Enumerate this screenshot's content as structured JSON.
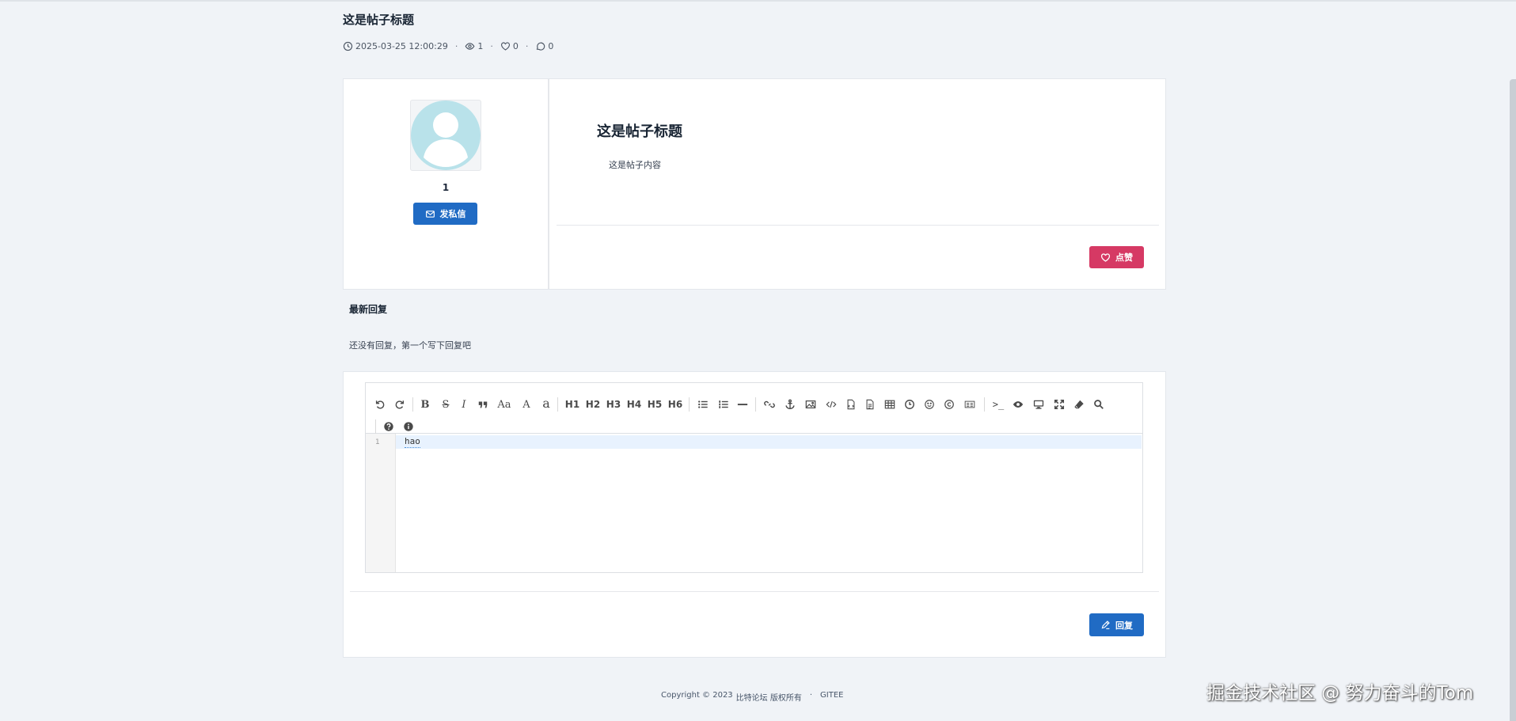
{
  "post": {
    "title": "这是帖子标题",
    "meta": {
      "datetime": "2025-03-25 12:00:29",
      "views": "1",
      "likes": "0",
      "comments": "0"
    },
    "author_name": "1",
    "pm_button_label": "发私信",
    "content_title": "这是帖子标题",
    "content_body": "这是帖子内容",
    "like_button_label": "点赞"
  },
  "replies": {
    "heading": "最新回复",
    "empty_text": "还没有回复，第一个写下回复吧"
  },
  "editor": {
    "toolbar_text": {
      "aa": "Aa",
      "a_upper": "A",
      "a_lower": "a",
      "h1": "H1",
      "h2": "H2",
      "h3": "H3",
      "h4": "H4",
      "h5": "H5",
      "h6": "H6",
      "bold": "B",
      "strike": "S",
      "italic": "I",
      "terminal": ">_"
    },
    "line_number": "1",
    "content": "hao",
    "submit_label": "回复"
  },
  "footer": {
    "copyright": "Copyright © 2023",
    "site_name": "比特论坛 版权所有",
    "separator": "·",
    "link": "GITEE"
  },
  "watermark": "掘金技术社区 @ 努力奋斗的Tom",
  "colors": {
    "primary": "#206bc4",
    "like": "#d63964",
    "background": "#f0f3f7"
  }
}
